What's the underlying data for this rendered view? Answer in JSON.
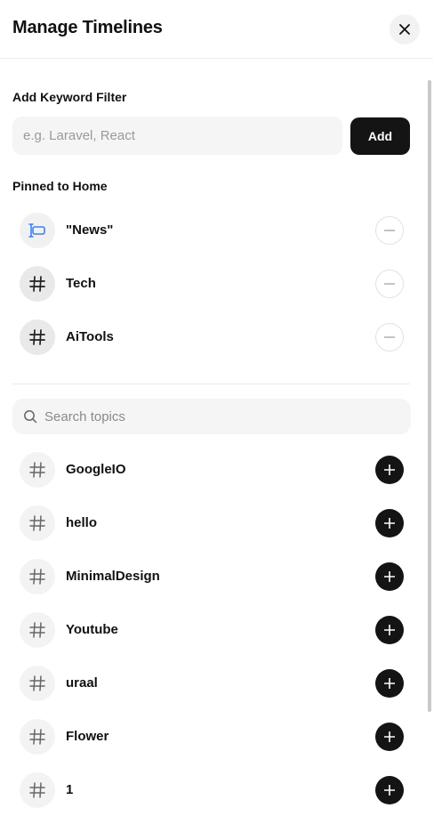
{
  "header": {
    "title": "Manage Timelines",
    "close_icon": "close-icon"
  },
  "keyword_filter": {
    "label": "Add Keyword Filter",
    "placeholder": "e.g. Laravel, React",
    "add_label": "Add"
  },
  "pinned": {
    "label": "Pinned to Home",
    "items": [
      {
        "label": "\"News\"",
        "icon": "keyword-icon"
      },
      {
        "label": "Tech",
        "icon": "hash-icon"
      },
      {
        "label": "AiTools",
        "icon": "hash-icon"
      }
    ]
  },
  "search": {
    "placeholder": "Search topics",
    "icon": "search-icon"
  },
  "topics": [
    {
      "label": "GoogleIO",
      "icon": "hash-icon"
    },
    {
      "label": "hello",
      "icon": "hash-icon"
    },
    {
      "label": "MinimalDesign",
      "icon": "hash-icon"
    },
    {
      "label": "Youtube",
      "icon": "hash-icon"
    },
    {
      "label": "uraal",
      "icon": "hash-icon"
    },
    {
      "label": "Flower",
      "icon": "hash-icon"
    },
    {
      "label": "1",
      "icon": "hash-icon"
    }
  ],
  "colors": {
    "accent_dark": "#141414",
    "keyword_icon": "#3b82f6",
    "surface": "#f5f5f5"
  }
}
